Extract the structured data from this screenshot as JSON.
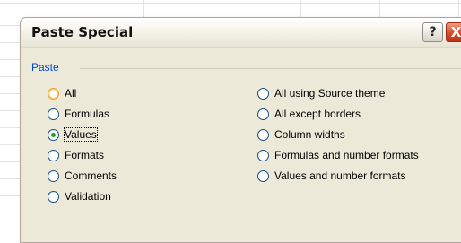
{
  "dialog": {
    "title": "Paste Special",
    "help_label": "?",
    "close_label": "X"
  },
  "paste_group": {
    "label": "Paste",
    "left_options": [
      {
        "label": "All",
        "state": "hover"
      },
      {
        "label": "Formulas",
        "state": "normal"
      },
      {
        "label": "Values",
        "state": "selected"
      },
      {
        "label": "Formats",
        "state": "normal"
      },
      {
        "label": "Comments",
        "state": "normal"
      },
      {
        "label": "Validation",
        "state": "normal"
      }
    ],
    "right_options": [
      {
        "label": "All using Source theme",
        "state": "normal"
      },
      {
        "label": "All except borders",
        "state": "normal"
      },
      {
        "label": "Column widths",
        "state": "normal"
      },
      {
        "label": "Formulas and number formats",
        "state": "normal"
      },
      {
        "label": "Values and number formats",
        "state": "normal"
      }
    ]
  },
  "colors": {
    "group_label": "#0046d5",
    "selected_dot": "#21a121",
    "hover_ring": "#e8a228",
    "close_button": "#d34e2c"
  },
  "icons": [
    "help-icon",
    "close-icon"
  ]
}
